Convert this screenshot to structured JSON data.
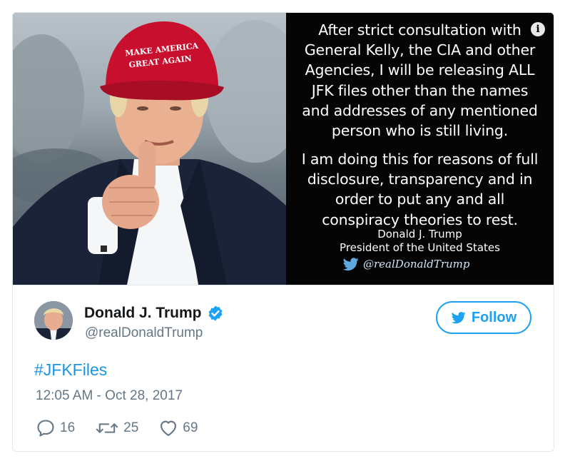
{
  "media": {
    "photo_alt": "",
    "hat_text_line1": "MAKE AMERICA",
    "hat_text_line2": "GREAT AGAIN",
    "quote_paragraph1": [
      "After strict consultation with",
      "General Kelly, the CIA and other",
      "Agencies, I will be releasing ALL",
      "JFK files other than the names",
      "and addresses of any mentioned",
      "person who is still living."
    ],
    "quote_paragraph2": [
      "I am doing this for reasons of full",
      "disclosure, transparency and in",
      "order to put any and all",
      "conspiracy theories to rest."
    ],
    "signature_name": "Donald J. Trump",
    "signature_title": "President of the United States",
    "signature_handle": "@realDonaldTrump",
    "info_icon": "i"
  },
  "author": {
    "display_name": "Donald J. Trump",
    "handle": "@realDonaldTrump",
    "verified_icon": "verified-badge-icon"
  },
  "follow_button": {
    "label": "Follow",
    "icon": "twitter-bird-icon"
  },
  "tweet": {
    "hashtag": "#JFKFiles",
    "timestamp": "12:05 AM - Oct 28, 2017"
  },
  "actions": {
    "replies": "16",
    "retweets": "25",
    "likes": "69"
  },
  "colors": {
    "accent": "#1da1f2",
    "link": "#1b95e0",
    "text_primary": "#14171a",
    "text_secondary": "#657786",
    "border": "#e1e8ed",
    "hat_red": "#c8102e"
  }
}
